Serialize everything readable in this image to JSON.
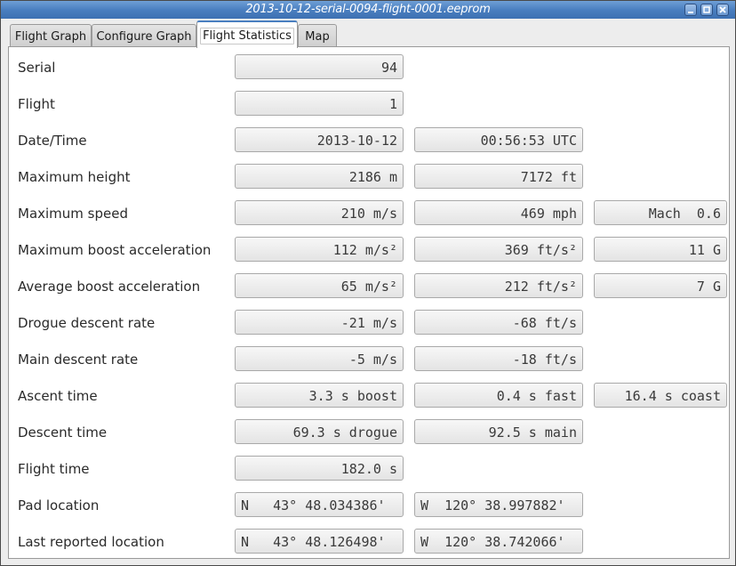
{
  "window": {
    "title": "2013-10-12-serial-0094-flight-0001.eeprom",
    "controls": [
      "minimize",
      "maximize",
      "close"
    ]
  },
  "tabs": [
    {
      "label": "Flight Graph",
      "active": false
    },
    {
      "label": "Configure Graph",
      "active": false
    },
    {
      "label": "Flight Statistics",
      "active": true
    },
    {
      "label": "Map",
      "active": false
    }
  ],
  "stats": [
    {
      "label": "Serial",
      "values": [
        "94"
      ]
    },
    {
      "label": "Flight",
      "values": [
        "1"
      ]
    },
    {
      "label": "Date/Time",
      "values": [
        "2013-10-12",
        "00:56:53 UTC"
      ]
    },
    {
      "label": "Maximum height",
      "values": [
        "2186 m",
        "7172 ft"
      ]
    },
    {
      "label": "Maximum speed",
      "values": [
        "210 m/s",
        "469 mph",
        "Mach  0.6"
      ]
    },
    {
      "label": "Maximum boost acceleration",
      "values": [
        "112 m/s²",
        "369 ft/s²",
        "11 G"
      ]
    },
    {
      "label": "Average boost acceleration",
      "values": [
        "65 m/s²",
        "212 ft/s²",
        "7 G"
      ]
    },
    {
      "label": "Drogue descent rate",
      "values": [
        "-21 m/s",
        "-68 ft/s"
      ]
    },
    {
      "label": "Main descent rate",
      "values": [
        "-5 m/s",
        "-18 ft/s"
      ]
    },
    {
      "label": "Ascent time",
      "values": [
        "3.3 s boost",
        "0.4 s fast",
        "16.4 s coast"
      ]
    },
    {
      "label": "Descent time",
      "values": [
        "69.3 s drogue",
        "92.5 s main"
      ]
    },
    {
      "label": "Flight time",
      "values": [
        "182.0 s"
      ]
    },
    {
      "label": "Pad location",
      "values": [
        "N   43° 48.034386'",
        "W  120° 38.997882'"
      ]
    },
    {
      "label": "Last reported location",
      "values": [
        "N   43° 48.126498'",
        "W  120° 38.742066'"
      ]
    }
  ]
}
